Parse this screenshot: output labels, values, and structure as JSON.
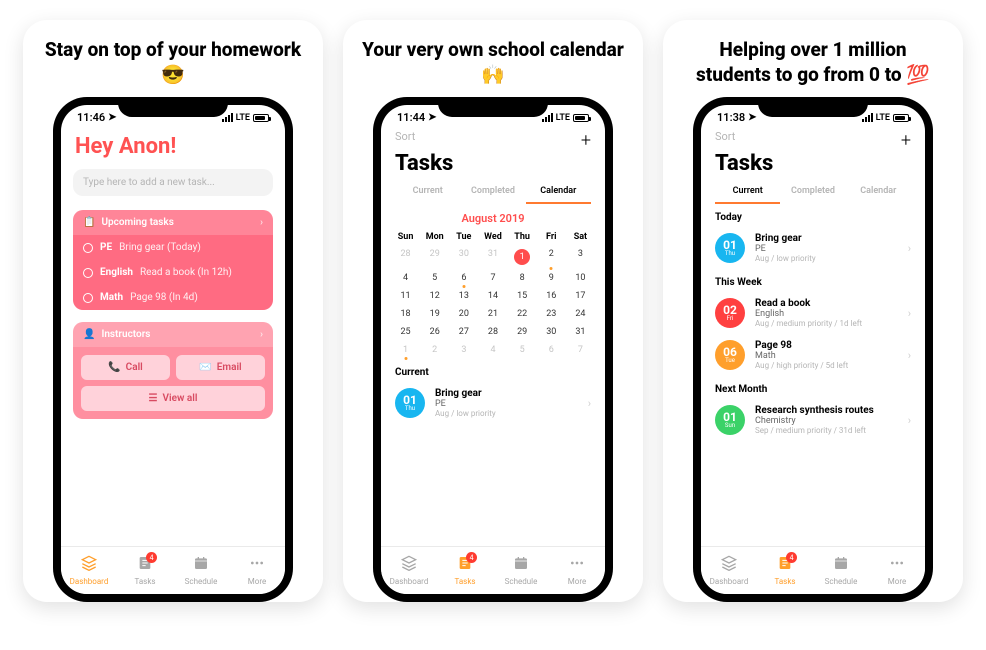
{
  "slides": [
    {
      "headline": "Stay on top of your homework 😎"
    },
    {
      "headline": "Your very own school calendar 🙌"
    },
    {
      "headline": "Helping over 1 million students to go from 0 to 💯"
    }
  ],
  "colors": {
    "accent": "#ff9f2c",
    "danger": "#ff4d4d",
    "cardPink": "#ff6b82"
  },
  "screen1": {
    "status": {
      "time": "11:46",
      "network": "LTE"
    },
    "greeting": "Hey Anon!",
    "input_placeholder": "Type here to add a new task...",
    "upcoming": {
      "title": "Upcoming tasks",
      "items": [
        {
          "subject": "PE",
          "detail": "Bring gear (Today)"
        },
        {
          "subject": "English",
          "detail": "Read a book (In 12h)"
        },
        {
          "subject": "Math",
          "detail": "Page 98 (In 4d)"
        }
      ]
    },
    "instructors": {
      "title": "Instructors",
      "call": "Call",
      "email": "Email",
      "viewall": "View all"
    }
  },
  "screen2": {
    "status": {
      "time": "11:44",
      "network": "LTE"
    },
    "sort": "Sort",
    "title": "Tasks",
    "tabs": [
      "Current",
      "Completed",
      "Calendar"
    ],
    "activeTab": "Calendar",
    "calendar": {
      "month": "August 2019",
      "days": [
        "Sun",
        "Mon",
        "Tue",
        "Wed",
        "Thu",
        "Fri",
        "Sat"
      ],
      "weeks": [
        [
          {
            "n": "28",
            "muted": true
          },
          {
            "n": "29",
            "muted": true
          },
          {
            "n": "30",
            "muted": true
          },
          {
            "n": "31",
            "muted": true
          },
          {
            "n": "1",
            "today": true
          },
          {
            "n": "2",
            "dot": true
          },
          {
            "n": "3"
          }
        ],
        [
          {
            "n": "4"
          },
          {
            "n": "5"
          },
          {
            "n": "6",
            "dot": true
          },
          {
            "n": "7"
          },
          {
            "n": "8"
          },
          {
            "n": "9"
          },
          {
            "n": "10"
          }
        ],
        [
          {
            "n": "11"
          },
          {
            "n": "12"
          },
          {
            "n": "13"
          },
          {
            "n": "14"
          },
          {
            "n": "15"
          },
          {
            "n": "16"
          },
          {
            "n": "17"
          }
        ],
        [
          {
            "n": "18"
          },
          {
            "n": "19"
          },
          {
            "n": "20"
          },
          {
            "n": "21"
          },
          {
            "n": "22"
          },
          {
            "n": "23"
          },
          {
            "n": "24"
          }
        ],
        [
          {
            "n": "25"
          },
          {
            "n": "26"
          },
          {
            "n": "27"
          },
          {
            "n": "28"
          },
          {
            "n": "29"
          },
          {
            "n": "30"
          },
          {
            "n": "31"
          }
        ],
        [
          {
            "n": "1",
            "muted": true,
            "dot": true
          },
          {
            "n": "2",
            "muted": true
          },
          {
            "n": "3",
            "muted": true
          },
          {
            "n": "4",
            "muted": true
          },
          {
            "n": "5",
            "muted": true
          },
          {
            "n": "6",
            "muted": true
          },
          {
            "n": "7",
            "muted": true
          }
        ]
      ]
    },
    "currentSection": {
      "label": "Current",
      "task": {
        "color": "c-blue",
        "day": "01",
        "weekday": "Thu",
        "title": "Bring gear",
        "subject": "PE",
        "meta": "Aug / low priority"
      }
    }
  },
  "screen3": {
    "status": {
      "time": "11:38",
      "network": "LTE"
    },
    "sort": "Sort",
    "title": "Tasks",
    "tabs": [
      "Current",
      "Completed",
      "Calendar"
    ],
    "activeTab": "Current",
    "sections": [
      {
        "label": "Today",
        "tasks": [
          {
            "color": "c-blue",
            "day": "01",
            "weekday": "Thu",
            "title": "Bring gear",
            "subject": "PE",
            "meta": "Aug / low priority"
          }
        ]
      },
      {
        "label": "This Week",
        "tasks": [
          {
            "color": "c-red",
            "day": "02",
            "weekday": "Fri",
            "title": "Read a book",
            "subject": "English",
            "meta": "Aug / medium priority / 1d left"
          },
          {
            "color": "c-orange",
            "day": "06",
            "weekday": "Tue",
            "title": "Page 98",
            "subject": "Math",
            "meta": "Aug / high priority / 5d left"
          }
        ]
      },
      {
        "label": "Next Month",
        "tasks": [
          {
            "color": "c-green",
            "day": "01",
            "weekday": "Sun",
            "title": "Research synthesis routes",
            "subject": "Chemistry",
            "meta": "Sep / medium priority / 31d left"
          }
        ]
      }
    ]
  },
  "tabbar": {
    "items": [
      {
        "label": "Dashboard",
        "icon": "layers-icon"
      },
      {
        "label": "Tasks",
        "icon": "tasks-icon",
        "badge": "4"
      },
      {
        "label": "Schedule",
        "icon": "calendar-icon"
      },
      {
        "label": "More",
        "icon": "more-icon"
      }
    ]
  }
}
